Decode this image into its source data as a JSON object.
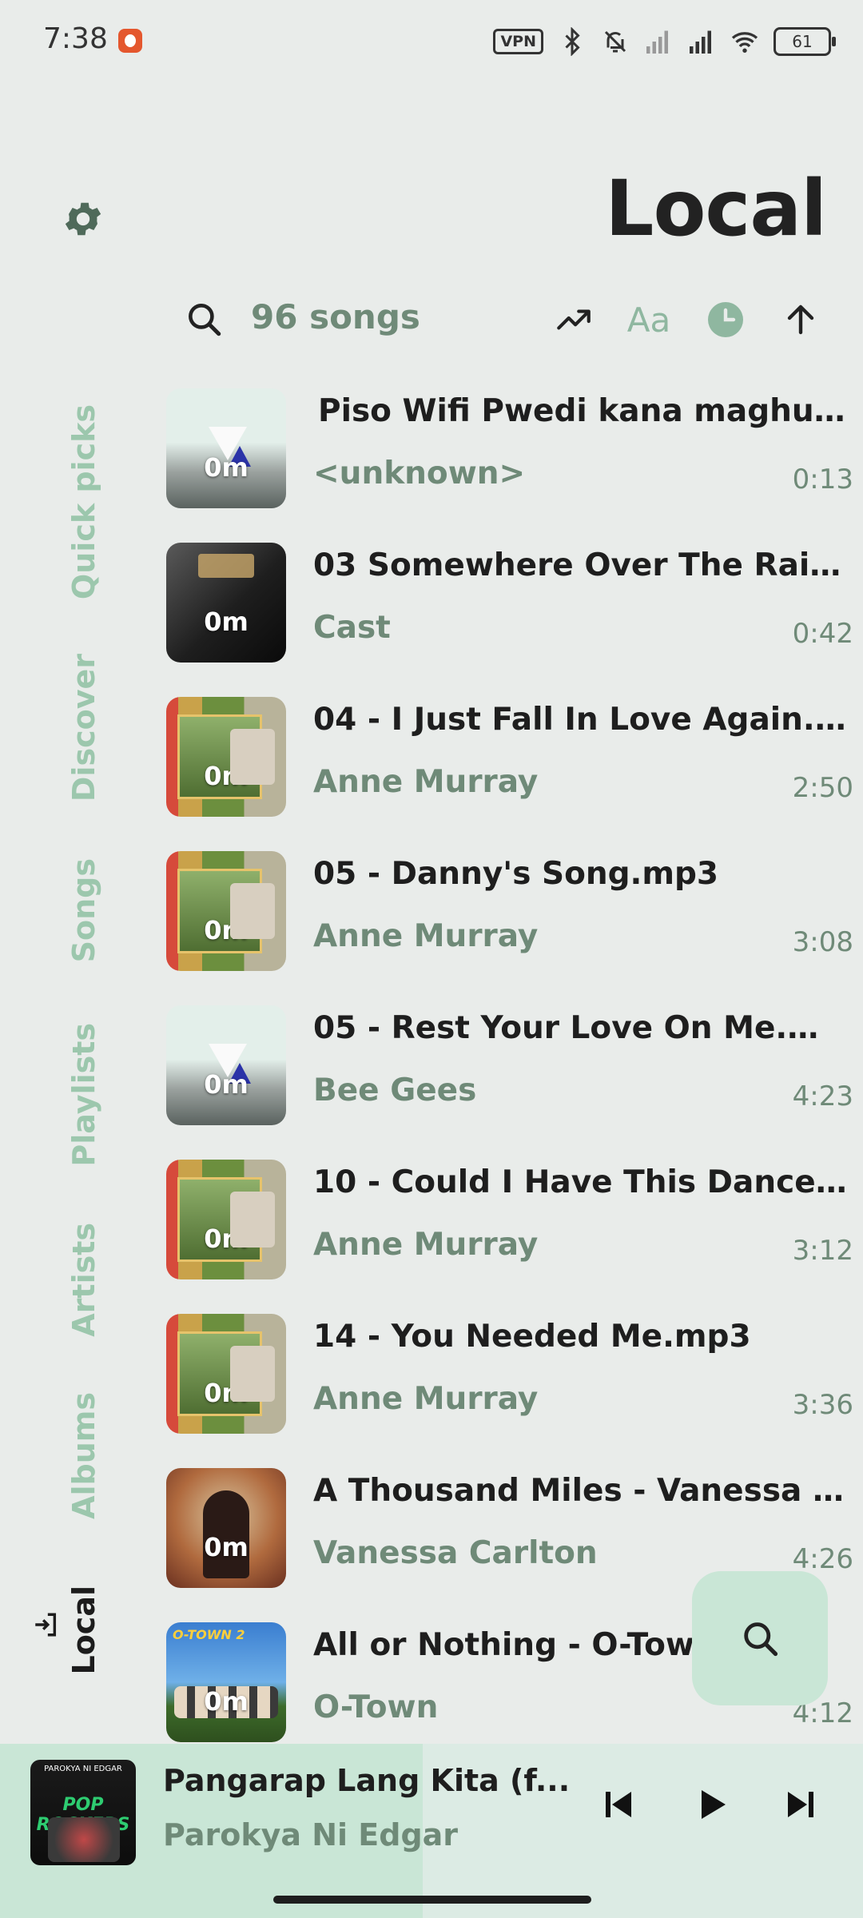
{
  "status_bar": {
    "time": "7:38",
    "vpn": "VPN",
    "battery": "61"
  },
  "header": {
    "title": "Local"
  },
  "toolbar": {
    "song_count": "96 songs",
    "font_toggle": "Aa"
  },
  "side_nav": {
    "items": [
      {
        "label": "Quick picks",
        "active": false
      },
      {
        "label": "Discover",
        "active": false
      },
      {
        "label": "Songs",
        "active": false
      },
      {
        "label": "Playlists",
        "active": false
      },
      {
        "label": "Artists",
        "active": false
      },
      {
        "label": "Albums",
        "active": false
      },
      {
        "label": "Local",
        "active": true
      }
    ]
  },
  "songs": [
    {
      "title": "Piso Wifi Pwedi kana maghulloo...",
      "artist": "<unknown>",
      "duration": "0:13",
      "badge": "0m",
      "art": "placeholder"
    },
    {
      "title": "03 Somewhere Over The Rainbo...",
      "artist": "Cast",
      "duration": "0:42",
      "badge": "0m",
      "art": "star-is-born"
    },
    {
      "title": "04 - I Just Fall In Love Again.mp3",
      "artist": "Anne Murray",
      "duration": "2:50",
      "badge": "0m",
      "art": "teen-years"
    },
    {
      "title": "05 - Danny's Song.mp3",
      "artist": "Anne Murray",
      "duration": "3:08",
      "badge": "0m",
      "art": "teen-years"
    },
    {
      "title": "05 - Rest Your Love On Me.mp3",
      "artist": "Bee Gees",
      "duration": "4:23",
      "badge": "0m",
      "art": "placeholder"
    },
    {
      "title": "10 - Could I Have This Dance.mp3",
      "artist": "Anne Murray",
      "duration": "3:12",
      "badge": "0m",
      "art": "teen-years"
    },
    {
      "title": "14 - You Needed Me.mp3",
      "artist": "Anne Murray",
      "duration": "3:36",
      "badge": "0m",
      "art": "teen-years"
    },
    {
      "title": "A Thousand Miles - Vanessa Car...",
      "artist": "Vanessa Carlton",
      "duration": "4:26",
      "badge": "0m",
      "art": "vanessa"
    },
    {
      "title": "All or Nothing - O-Town.m",
      "artist": "O-Town",
      "duration": "4:12",
      "badge": "0m",
      "art": "o-town"
    }
  ],
  "art_text": {
    "otown_logo": "O-TOWN 2",
    "player_band": "PAROKYA NI EDGAR",
    "player_album": "POP ROCKERS"
  },
  "now_playing": {
    "title": "Pangarap Lang Kita (f...",
    "artist": "Parokya Ni Edgar",
    "progress": 0.49
  },
  "colors": {
    "accent": "#6f8a78",
    "nav_inactive": "#9cc7ad",
    "fab_bg": "#c9e6d6",
    "background": "#e9ecea"
  }
}
